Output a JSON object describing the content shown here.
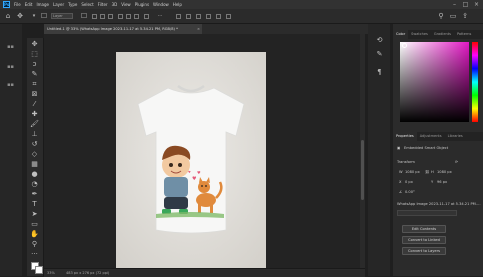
{
  "app": {
    "logo": "Ps"
  },
  "menu": [
    "File",
    "Edit",
    "Image",
    "Layer",
    "Type",
    "Select",
    "Filter",
    "3D",
    "View",
    "Plugins",
    "Window",
    "Help"
  ],
  "window_controls": {
    "minimize": "–",
    "maximize": "□",
    "close": "×"
  },
  "options_bar": {
    "mode_value": "Layer",
    "home_icon": "home-icon",
    "move_icon": "move-icon"
  },
  "document": {
    "tab_title": "Untitled-1 @ 33% (WhatsApp Image 2023-11-17 at 5.34.21 PM, RGB/8) *",
    "tab_close": "×"
  },
  "status_bar": {
    "zoom": "33%",
    "doc_info": "483 px x 276 px (72 ppi)"
  },
  "color_panel": {
    "tabs": [
      "Color",
      "Swatches",
      "Gradients",
      "Patterns"
    ],
    "active_tab": "Color",
    "hue_color": "#e218c4"
  },
  "properties_panel": {
    "tabs": [
      "Properties",
      "Adjustments",
      "Libraries"
    ],
    "active_tab": "Properties",
    "layer_type": "Embedded Smart Object",
    "section_transform": "Transform",
    "w_label": "W",
    "w_value": "1080 px",
    "h_label": "H",
    "h_value": "1080 px",
    "x_label": "X",
    "x_value": "0 px",
    "y_label": "Y",
    "y_value": "96 px",
    "angle_value": "0.00°",
    "file_name": "WhatsApp Image 2023-11-17 at 5.34.21 PM.jpg",
    "buttons": [
      "Edit Contents",
      "Convert to Linked",
      "Convert to Layers"
    ]
  },
  "accent_colors": {
    "ps_blue": "#31a8ff",
    "panel_bg": "#2b2b2b",
    "canvas_bg": "#232323"
  }
}
